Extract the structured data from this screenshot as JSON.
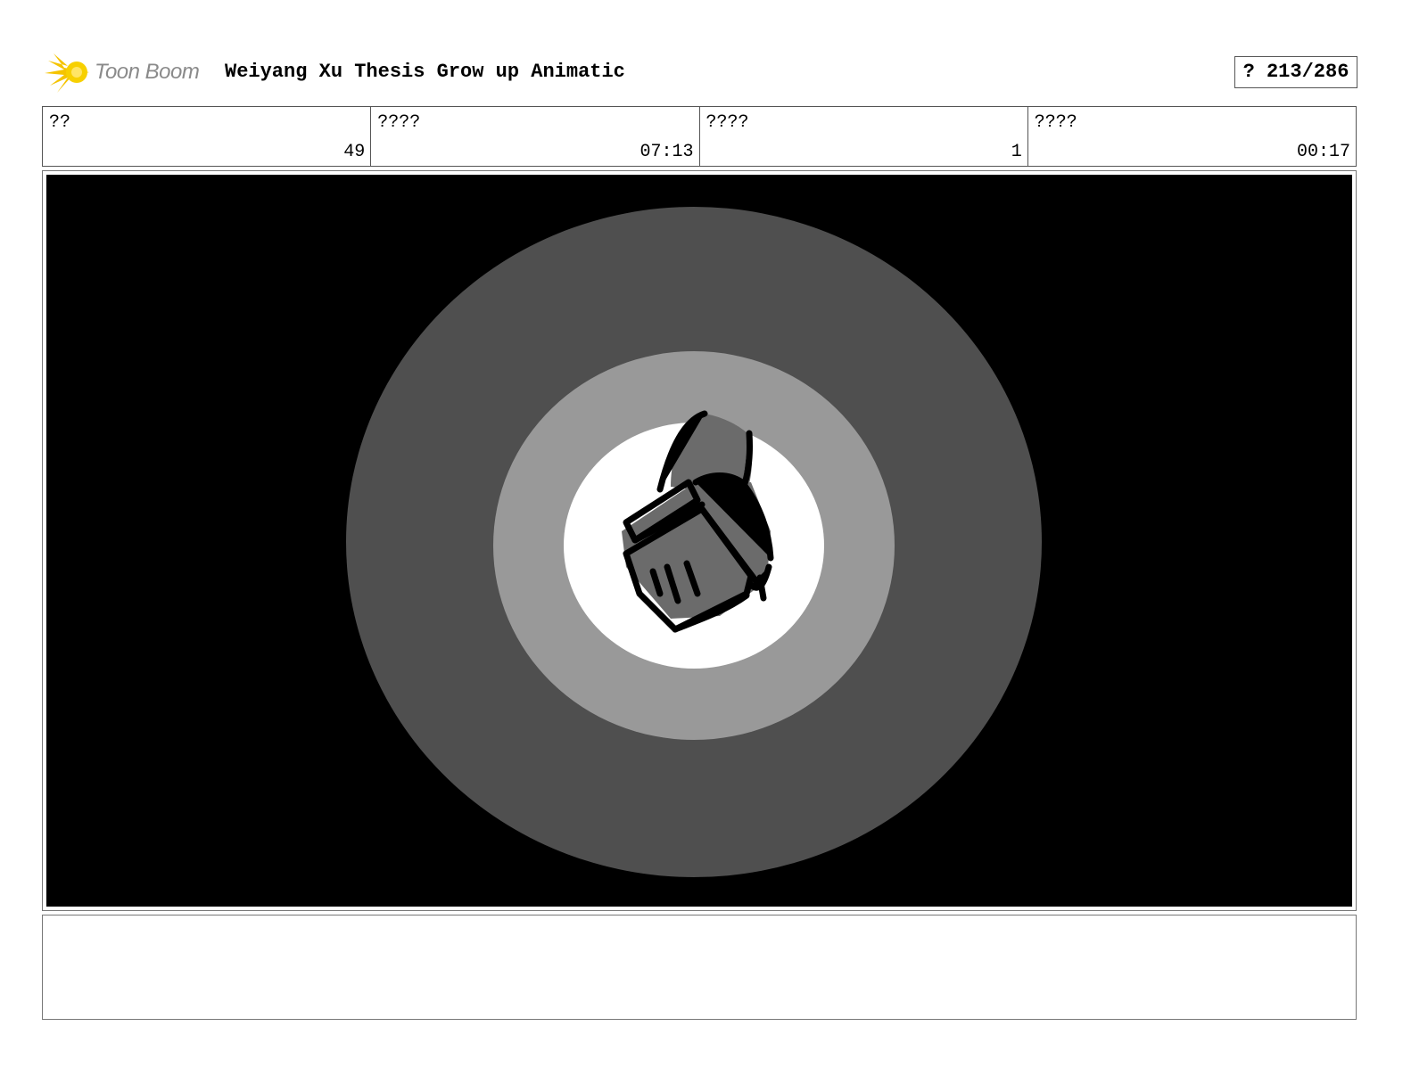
{
  "header": {
    "logo_text": "Toon Boom",
    "project_title": "Weiyang Xu Thesis Grow up Animatic",
    "page_indicator": "? 213/286"
  },
  "info": [
    {
      "label": "??",
      "value": "49"
    },
    {
      "label": "????",
      "value": "07:13"
    },
    {
      "label": "????",
      "value": "1"
    },
    {
      "label": "????",
      "value": "00:17"
    }
  ],
  "panel": {
    "background": "#000000",
    "ring_outer_color": "#4f4f4f",
    "ring_middle_color": "#999999",
    "ring_inner_color": "#ffffff",
    "sketch_fill_color": "#6b6b6b",
    "subject": "chair-sketch"
  },
  "notes": {
    "text": ""
  },
  "colors": {
    "logo_accent": "#f5c400",
    "logo_text": "#8a8a8a",
    "border": "#555555"
  }
}
